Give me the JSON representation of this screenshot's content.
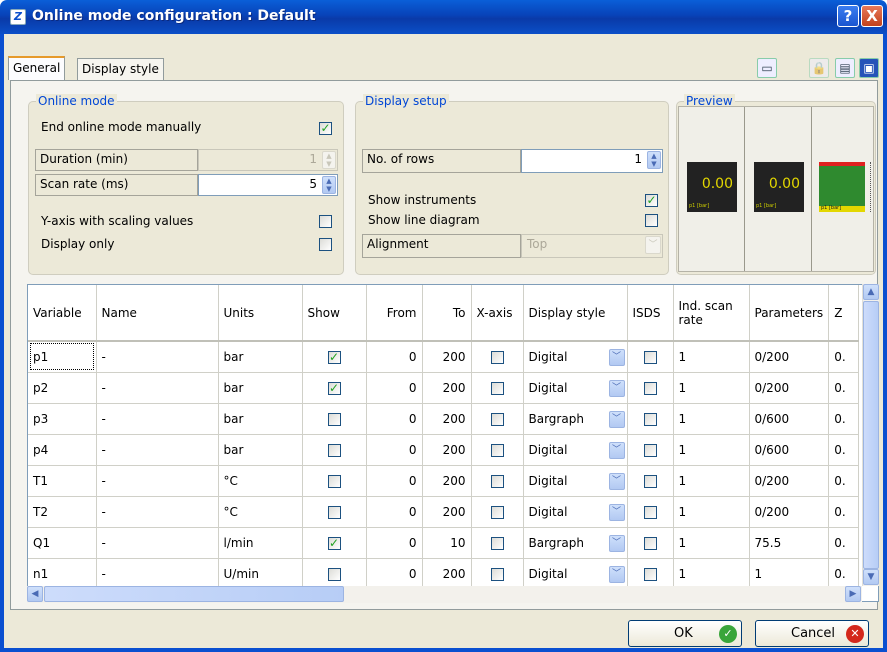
{
  "window": {
    "title": "Online mode configuration : Default",
    "help": "?",
    "close": "X"
  },
  "tabs": [
    {
      "label": "General"
    },
    {
      "label": "Display style"
    }
  ],
  "online_mode": {
    "legend": "Online mode",
    "end_manually_label": "End online mode manually",
    "end_manually_checked": true,
    "duration_label": "Duration (min)",
    "duration_value": "1",
    "scan_rate_label": "Scan rate (ms)",
    "scan_rate_value": "5",
    "yaxis_label": "Y-axis with scaling values",
    "yaxis_checked": false,
    "display_only_label": "Display only",
    "display_only_checked": false
  },
  "display_setup": {
    "legend": "Display setup",
    "rows_label": "No. of rows",
    "rows_value": "1",
    "show_instruments_label": "Show instruments",
    "show_instruments_checked": true,
    "show_line_label": "Show line diagram",
    "show_line_checked": false,
    "alignment_label": "Alignment",
    "alignment_value": "Top"
  },
  "preview": {
    "legend": "Preview",
    "digital1_value": "0.00",
    "digital1_unit": "p1 [bar]",
    "digital2_value": "0.00",
    "digital2_unit": "p1 [bar]",
    "bar_unit": "p1 [bar]"
  },
  "table": {
    "columns": [
      "Variable",
      "Name",
      "Units",
      "Show",
      "From",
      "To",
      "X-axis",
      "Display style",
      "ISDS",
      "Ind. scan rate",
      "Parameters",
      "Z"
    ],
    "rows": [
      {
        "variable": "p1",
        "name": "-",
        "units": "bar",
        "show": true,
        "from": "0",
        "to": "200",
        "xaxis": false,
        "style": "Digital",
        "isds": false,
        "scan": "1",
        "params": "0/200",
        "z": "0."
      },
      {
        "variable": "p2",
        "name": "-",
        "units": "bar",
        "show": true,
        "from": "0",
        "to": "200",
        "xaxis": false,
        "style": "Digital",
        "isds": false,
        "scan": "1",
        "params": "0/200",
        "z": "0."
      },
      {
        "variable": "p3",
        "name": "-",
        "units": "bar",
        "show": false,
        "from": "0",
        "to": "200",
        "xaxis": false,
        "style": "Bargraph",
        "isds": false,
        "scan": "1",
        "params": "0/600",
        "z": "0."
      },
      {
        "variable": "p4",
        "name": "-",
        "units": "bar",
        "show": false,
        "from": "0",
        "to": "200",
        "xaxis": false,
        "style": "Digital",
        "isds": false,
        "scan": "1",
        "params": "0/600",
        "z": "0."
      },
      {
        "variable": "T1",
        "name": "-",
        "units": "°C",
        "show": false,
        "from": "0",
        "to": "200",
        "xaxis": false,
        "style": "Digital",
        "isds": false,
        "scan": "1",
        "params": "0/200",
        "z": "0."
      },
      {
        "variable": "T2",
        "name": "-",
        "units": "°C",
        "show": false,
        "from": "0",
        "to": "200",
        "xaxis": false,
        "style": "Digital",
        "isds": false,
        "scan": "1",
        "params": "0/200",
        "z": "0."
      },
      {
        "variable": "Q1",
        "name": "-",
        "units": "l/min",
        "show": true,
        "from": "0",
        "to": "10",
        "xaxis": false,
        "style": "Bargraph",
        "isds": false,
        "scan": "1",
        "params": "75.5",
        "z": "0."
      },
      {
        "variable": "n1",
        "name": "-",
        "units": "U/min",
        "show": false,
        "from": "0",
        "to": "200",
        "xaxis": false,
        "style": "Digital",
        "isds": false,
        "scan": "1",
        "params": "1",
        "z": "0."
      }
    ]
  },
  "buttons": {
    "ok": "OK",
    "cancel": "Cancel"
  },
  "colors": {
    "title_bar": "#0842b8",
    "group_title": "#0046d5",
    "check": "#21a121",
    "digital_text": "#e3d700",
    "bar_green": "#2f8a2f",
    "bar_red": "#e02020"
  }
}
